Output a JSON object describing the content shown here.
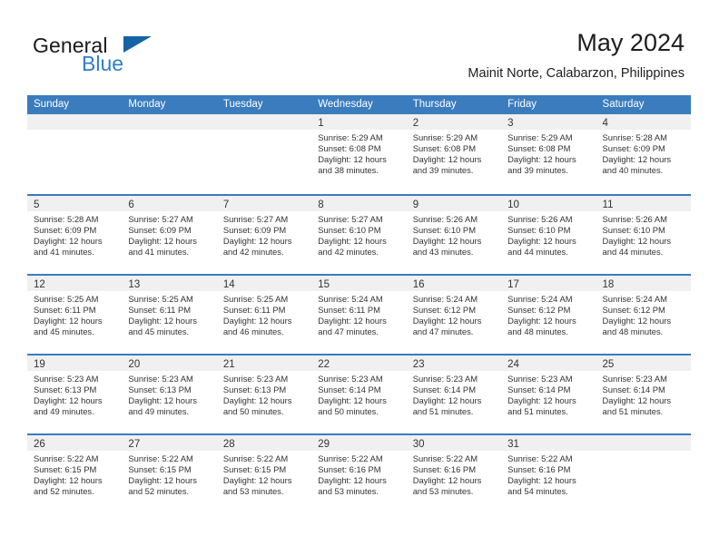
{
  "brand": {
    "name_primary": "General",
    "name_secondary": "Blue",
    "accent_color": "#1464a5"
  },
  "header": {
    "title": "May 2024",
    "subtitle": "Mainit Norte, Calabarzon, Philippines"
  },
  "calendar": {
    "header_bg_color": "#3a7cbe",
    "day_band_color": "#f0f0f0",
    "weekdays": [
      "Sunday",
      "Monday",
      "Tuesday",
      "Wednesday",
      "Thursday",
      "Friday",
      "Saturday"
    ],
    "weeks": [
      [
        {
          "day": "",
          "empty": true
        },
        {
          "day": "",
          "empty": true
        },
        {
          "day": "",
          "empty": true
        },
        {
          "day": "1",
          "sunrise": "Sunrise: 5:29 AM",
          "sunset": "Sunset: 6:08 PM",
          "daylight1": "Daylight: 12 hours",
          "daylight2": "and 38 minutes."
        },
        {
          "day": "2",
          "sunrise": "Sunrise: 5:29 AM",
          "sunset": "Sunset: 6:08 PM",
          "daylight1": "Daylight: 12 hours",
          "daylight2": "and 39 minutes."
        },
        {
          "day": "3",
          "sunrise": "Sunrise: 5:29 AM",
          "sunset": "Sunset: 6:08 PM",
          "daylight1": "Daylight: 12 hours",
          "daylight2": "and 39 minutes."
        },
        {
          "day": "4",
          "sunrise": "Sunrise: 5:28 AM",
          "sunset": "Sunset: 6:09 PM",
          "daylight1": "Daylight: 12 hours",
          "daylight2": "and 40 minutes."
        }
      ],
      [
        {
          "day": "5",
          "sunrise": "Sunrise: 5:28 AM",
          "sunset": "Sunset: 6:09 PM",
          "daylight1": "Daylight: 12 hours",
          "daylight2": "and 41 minutes."
        },
        {
          "day": "6",
          "sunrise": "Sunrise: 5:27 AM",
          "sunset": "Sunset: 6:09 PM",
          "daylight1": "Daylight: 12 hours",
          "daylight2": "and 41 minutes."
        },
        {
          "day": "7",
          "sunrise": "Sunrise: 5:27 AM",
          "sunset": "Sunset: 6:09 PM",
          "daylight1": "Daylight: 12 hours",
          "daylight2": "and 42 minutes."
        },
        {
          "day": "8",
          "sunrise": "Sunrise: 5:27 AM",
          "sunset": "Sunset: 6:10 PM",
          "daylight1": "Daylight: 12 hours",
          "daylight2": "and 42 minutes."
        },
        {
          "day": "9",
          "sunrise": "Sunrise: 5:26 AM",
          "sunset": "Sunset: 6:10 PM",
          "daylight1": "Daylight: 12 hours",
          "daylight2": "and 43 minutes."
        },
        {
          "day": "10",
          "sunrise": "Sunrise: 5:26 AM",
          "sunset": "Sunset: 6:10 PM",
          "daylight1": "Daylight: 12 hours",
          "daylight2": "and 44 minutes."
        },
        {
          "day": "11",
          "sunrise": "Sunrise: 5:26 AM",
          "sunset": "Sunset: 6:10 PM",
          "daylight1": "Daylight: 12 hours",
          "daylight2": "and 44 minutes."
        }
      ],
      [
        {
          "day": "12",
          "sunrise": "Sunrise: 5:25 AM",
          "sunset": "Sunset: 6:11 PM",
          "daylight1": "Daylight: 12 hours",
          "daylight2": "and 45 minutes."
        },
        {
          "day": "13",
          "sunrise": "Sunrise: 5:25 AM",
          "sunset": "Sunset: 6:11 PM",
          "daylight1": "Daylight: 12 hours",
          "daylight2": "and 45 minutes."
        },
        {
          "day": "14",
          "sunrise": "Sunrise: 5:25 AM",
          "sunset": "Sunset: 6:11 PM",
          "daylight1": "Daylight: 12 hours",
          "daylight2": "and 46 minutes."
        },
        {
          "day": "15",
          "sunrise": "Sunrise: 5:24 AM",
          "sunset": "Sunset: 6:11 PM",
          "daylight1": "Daylight: 12 hours",
          "daylight2": "and 47 minutes."
        },
        {
          "day": "16",
          "sunrise": "Sunrise: 5:24 AM",
          "sunset": "Sunset: 6:12 PM",
          "daylight1": "Daylight: 12 hours",
          "daylight2": "and 47 minutes."
        },
        {
          "day": "17",
          "sunrise": "Sunrise: 5:24 AM",
          "sunset": "Sunset: 6:12 PM",
          "daylight1": "Daylight: 12 hours",
          "daylight2": "and 48 minutes."
        },
        {
          "day": "18",
          "sunrise": "Sunrise: 5:24 AM",
          "sunset": "Sunset: 6:12 PM",
          "daylight1": "Daylight: 12 hours",
          "daylight2": "and 48 minutes."
        }
      ],
      [
        {
          "day": "19",
          "sunrise": "Sunrise: 5:23 AM",
          "sunset": "Sunset: 6:13 PM",
          "daylight1": "Daylight: 12 hours",
          "daylight2": "and 49 minutes."
        },
        {
          "day": "20",
          "sunrise": "Sunrise: 5:23 AM",
          "sunset": "Sunset: 6:13 PM",
          "daylight1": "Daylight: 12 hours",
          "daylight2": "and 49 minutes."
        },
        {
          "day": "21",
          "sunrise": "Sunrise: 5:23 AM",
          "sunset": "Sunset: 6:13 PM",
          "daylight1": "Daylight: 12 hours",
          "daylight2": "and 50 minutes."
        },
        {
          "day": "22",
          "sunrise": "Sunrise: 5:23 AM",
          "sunset": "Sunset: 6:14 PM",
          "daylight1": "Daylight: 12 hours",
          "daylight2": "and 50 minutes."
        },
        {
          "day": "23",
          "sunrise": "Sunrise: 5:23 AM",
          "sunset": "Sunset: 6:14 PM",
          "daylight1": "Daylight: 12 hours",
          "daylight2": "and 51 minutes."
        },
        {
          "day": "24",
          "sunrise": "Sunrise: 5:23 AM",
          "sunset": "Sunset: 6:14 PM",
          "daylight1": "Daylight: 12 hours",
          "daylight2": "and 51 minutes."
        },
        {
          "day": "25",
          "sunrise": "Sunrise: 5:23 AM",
          "sunset": "Sunset: 6:14 PM",
          "daylight1": "Daylight: 12 hours",
          "daylight2": "and 51 minutes."
        }
      ],
      [
        {
          "day": "26",
          "sunrise": "Sunrise: 5:22 AM",
          "sunset": "Sunset: 6:15 PM",
          "daylight1": "Daylight: 12 hours",
          "daylight2": "and 52 minutes."
        },
        {
          "day": "27",
          "sunrise": "Sunrise: 5:22 AM",
          "sunset": "Sunset: 6:15 PM",
          "daylight1": "Daylight: 12 hours",
          "daylight2": "and 52 minutes."
        },
        {
          "day": "28",
          "sunrise": "Sunrise: 5:22 AM",
          "sunset": "Sunset: 6:15 PM",
          "daylight1": "Daylight: 12 hours",
          "daylight2": "and 53 minutes."
        },
        {
          "day": "29",
          "sunrise": "Sunrise: 5:22 AM",
          "sunset": "Sunset: 6:16 PM",
          "daylight1": "Daylight: 12 hours",
          "daylight2": "and 53 minutes."
        },
        {
          "day": "30",
          "sunrise": "Sunrise: 5:22 AM",
          "sunset": "Sunset: 6:16 PM",
          "daylight1": "Daylight: 12 hours",
          "daylight2": "and 53 minutes."
        },
        {
          "day": "31",
          "sunrise": "Sunrise: 5:22 AM",
          "sunset": "Sunset: 6:16 PM",
          "daylight1": "Daylight: 12 hours",
          "daylight2": "and 54 minutes."
        },
        {
          "day": "",
          "empty": true
        }
      ]
    ]
  }
}
